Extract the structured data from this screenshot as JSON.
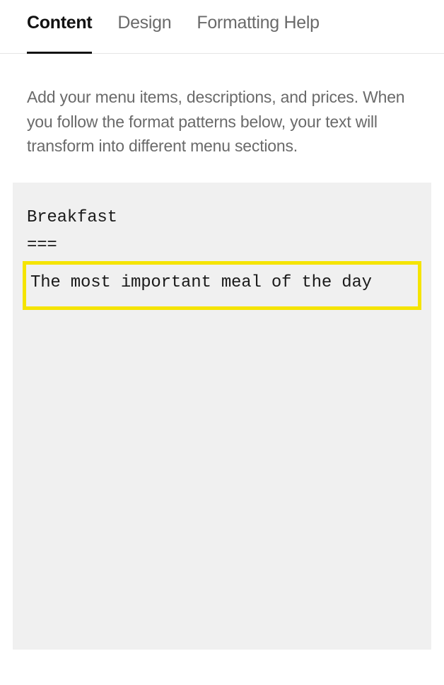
{
  "tabs": [
    {
      "label": "Content",
      "active": true
    },
    {
      "label": "Design",
      "active": false
    },
    {
      "label": "Formatting Help",
      "active": false
    }
  ],
  "description": "Add your menu items, descriptions, and prices. When you follow the format patterns below, your text will transform into different menu sections.",
  "editor": {
    "line1": "Breakfast",
    "line2": "===",
    "highlighted": "The most important meal of the day"
  },
  "colors": {
    "highlight": "#f5e400",
    "textPrimary": "#121212",
    "textSecondary": "#6a6a6a",
    "editorBg": "#f0f0f0"
  }
}
